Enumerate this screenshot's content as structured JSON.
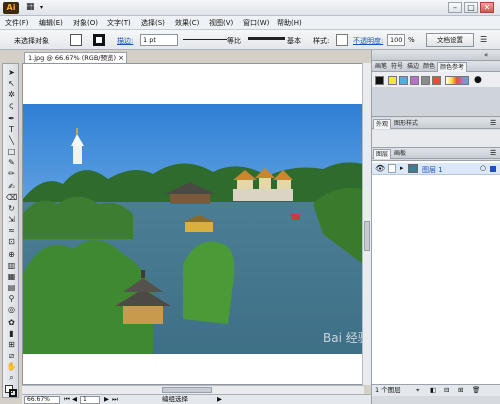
{
  "app": {
    "logo": "Ai",
    "menu_icon": "▦"
  },
  "window": {
    "minimize": "–",
    "maximize": "□",
    "close": "✕"
  },
  "menu": [
    {
      "label": "文件(F)"
    },
    {
      "label": "编辑(E)"
    },
    {
      "label": "对象(O)"
    },
    {
      "label": "文字(T)"
    },
    {
      "label": "选择(S)"
    },
    {
      "label": "效果(C)"
    },
    {
      "label": "视图(V)"
    },
    {
      "label": "窗口(W)"
    },
    {
      "label": "帮助(H)"
    }
  ],
  "control": {
    "selection_status": "未选择对象",
    "stroke_label": "描边:",
    "stroke_value": "1 pt",
    "line_ratio": "等比",
    "brush": "基本",
    "style_label": "样式:",
    "opacity_label": "不透明度:",
    "opacity_value": "100",
    "opacity_unit": "%",
    "doc_settings": "文档设置"
  },
  "document": {
    "tab_title": "1.jpg @ 66.67% (RGB/预览)",
    "tab_close": "×"
  },
  "status": {
    "zoom": "66.67%",
    "page": "1",
    "mode": "编组选择"
  },
  "panels": {
    "top_tabs": [
      "画笔",
      "符号",
      "描边",
      "颜色",
      "颜色参考"
    ],
    "middle_tabs": [
      "外观",
      "图形样式"
    ],
    "layer_tabs": [
      "图层",
      "画板"
    ],
    "layer_name": "图层 1",
    "footer": "1 个图层"
  },
  "colors": {
    "accent": "#1f4fbf",
    "selection": "#dbe8f7",
    "swatches": [
      "#f2e83a",
      "#4bb2d8",
      "#b574c8",
      "#8b8b8b",
      "#e94b3c"
    ]
  }
}
